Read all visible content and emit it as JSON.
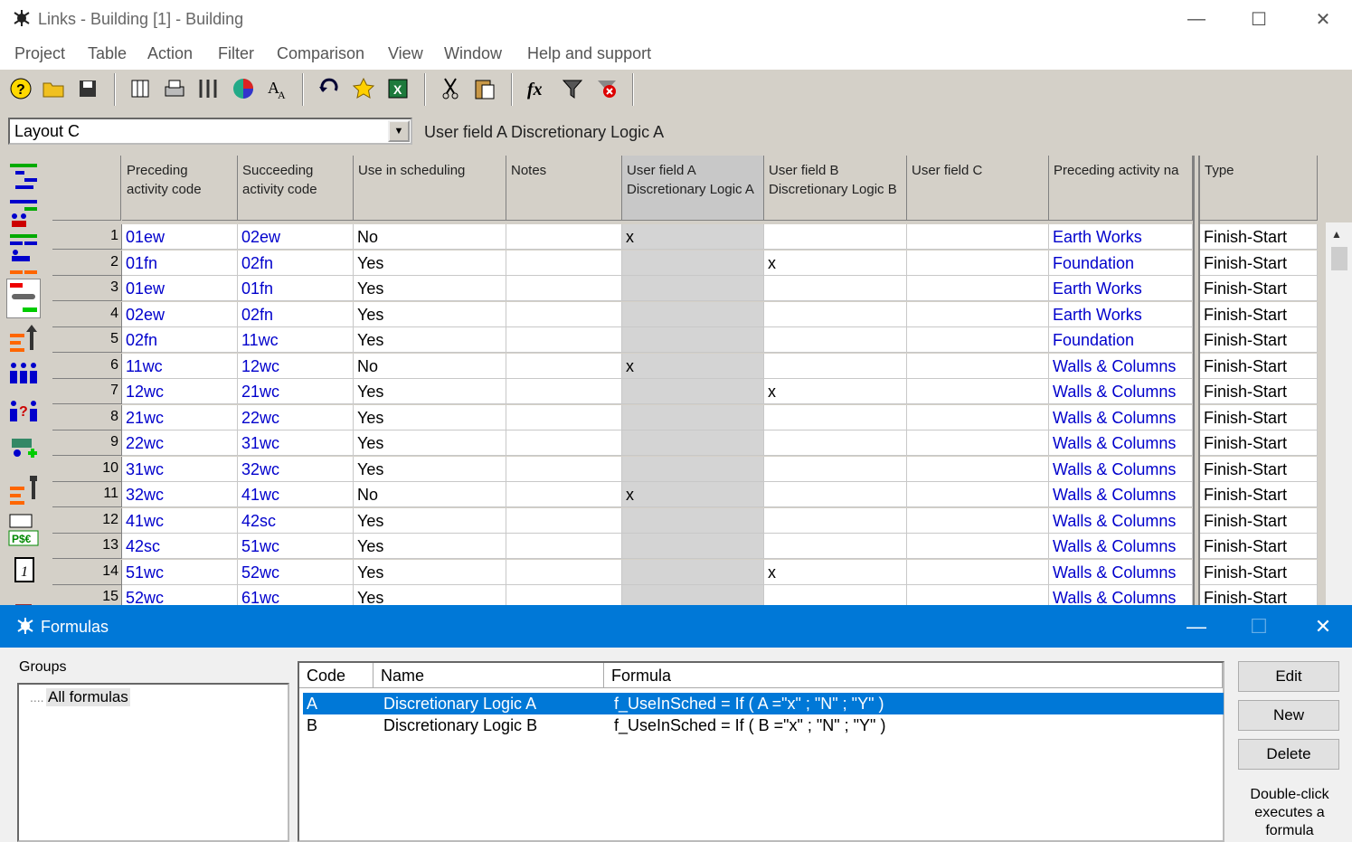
{
  "window": {
    "title": "Links - Building [1] - Building",
    "minimize": "—",
    "maximize": "☐",
    "close": "✕"
  },
  "menu": [
    "Project",
    "Table",
    "Action",
    "Filter",
    "Comparison",
    "View",
    "Window",
    "Help and support"
  ],
  "toolbar_icons": [
    "help-icon",
    "open-folder-icon",
    "save-icon",
    "columns-icon",
    "print-icon",
    "tools-icon",
    "pie-chart-icon",
    "font-icon",
    "undo-icon",
    "star-icon",
    "excel-icon",
    "cut-icon",
    "paste-icon",
    "formula-icon",
    "filter-icon",
    "clear-filter-icon"
  ],
  "layout": {
    "selected": "Layout C",
    "field_caption": "User field A Discretionary Logic A"
  },
  "grid": {
    "columns": [
      {
        "label": "Preceding activity code"
      },
      {
        "label": "Succeeding activity code"
      },
      {
        "label": "Use in scheduling"
      },
      {
        "label": "Notes"
      },
      {
        "label": "User field A Discretionary Logic A"
      },
      {
        "label": "User field B Discretionary Logic B"
      },
      {
        "label": "User field C"
      },
      {
        "label": "Preceding activity na"
      },
      {
        "label": "Type"
      }
    ],
    "rows": [
      {
        "n": "1",
        "pre": "01ew",
        "suc": "02ew",
        "use": "No",
        "notes": "",
        "ufa": "x",
        "ufb": "",
        "ufc": "",
        "name": "Earth Works",
        "type": "Finish-Start"
      },
      {
        "n": "2",
        "pre": "01fn",
        "suc": "02fn",
        "use": "Yes",
        "notes": "",
        "ufa": "",
        "ufb": "x",
        "ufc": "",
        "name": "Foundation",
        "type": "Finish-Start"
      },
      {
        "n": "3",
        "pre": "01ew",
        "suc": "01fn",
        "use": "Yes",
        "notes": "",
        "ufa": "",
        "ufb": "",
        "ufc": "",
        "name": "Earth Works",
        "type": "Finish-Start"
      },
      {
        "n": "4",
        "pre": "02ew",
        "suc": "02fn",
        "use": "Yes",
        "notes": "",
        "ufa": "",
        "ufb": "",
        "ufc": "",
        "name": "Earth Works",
        "type": "Finish-Start"
      },
      {
        "n": "5",
        "pre": "02fn",
        "suc": "11wc",
        "use": "Yes",
        "notes": "",
        "ufa": "",
        "ufb": "",
        "ufc": "",
        "name": "Foundation",
        "type": "Finish-Start"
      },
      {
        "n": "6",
        "pre": "11wc",
        "suc": "12wc",
        "use": "No",
        "notes": "",
        "ufa": "x",
        "ufb": "",
        "ufc": "",
        "name": "Walls & Columns",
        "type": "Finish-Start"
      },
      {
        "n": "7",
        "pre": "12wc",
        "suc": "21wc",
        "use": "Yes",
        "notes": "",
        "ufa": "",
        "ufb": "x",
        "ufc": "",
        "name": "Walls & Columns",
        "type": "Finish-Start"
      },
      {
        "n": "8",
        "pre": "21wc",
        "suc": "22wc",
        "use": "Yes",
        "notes": "",
        "ufa": "",
        "ufb": "",
        "ufc": "",
        "name": "Walls & Columns",
        "type": "Finish-Start"
      },
      {
        "n": "9",
        "pre": "22wc",
        "suc": "31wc",
        "use": "Yes",
        "notes": "",
        "ufa": "",
        "ufb": "",
        "ufc": "",
        "name": "Walls & Columns",
        "type": "Finish-Start"
      },
      {
        "n": "10",
        "pre": "31wc",
        "suc": "32wc",
        "use": "Yes",
        "notes": "",
        "ufa": "",
        "ufb": "",
        "ufc": "",
        "name": "Walls & Columns",
        "type": "Finish-Start"
      },
      {
        "n": "11",
        "pre": "32wc",
        "suc": "41wc",
        "use": "No",
        "notes": "",
        "ufa": "x",
        "ufb": "",
        "ufc": "",
        "name": "Walls & Columns",
        "type": "Finish-Start"
      },
      {
        "n": "12",
        "pre": "41wc",
        "suc": "42sc",
        "use": "Yes",
        "notes": "",
        "ufa": "",
        "ufb": "",
        "ufc": "",
        "name": "Walls & Columns",
        "type": "Finish-Start"
      },
      {
        "n": "13",
        "pre": "42sc",
        "suc": "51wc",
        "use": "Yes",
        "notes": "",
        "ufa": "",
        "ufb": "",
        "ufc": "",
        "name": "Walls & Columns",
        "type": "Finish-Start"
      },
      {
        "n": "14",
        "pre": "51wc",
        "suc": "52wc",
        "use": "Yes",
        "notes": "",
        "ufa": "",
        "ufb": "x",
        "ufc": "",
        "name": "Walls & Columns",
        "type": "Finish-Start"
      },
      {
        "n": "15",
        "pre": "52wc",
        "suc": "61wc",
        "use": "Yes",
        "notes": "",
        "ufa": "",
        "ufb": "",
        "ufc": "",
        "name": "Walls & Columns",
        "type": "Finish-Start"
      }
    ]
  },
  "formulas": {
    "title": "Formulas",
    "groups_label": "Groups",
    "groups": [
      "All formulas"
    ],
    "headers": {
      "code": "Code",
      "name": "Name",
      "formula": "Formula"
    },
    "rows": [
      {
        "code": "A",
        "name": "Discretionary Logic A",
        "formula": "f_UseInSched =  If (  A =\"x\" ; \"N\" ; \"Y\" )"
      },
      {
        "code": "B",
        "name": "Discretionary Logic B",
        "formula": "f_UseInSched =  If (  B =\"x\" ; \"N\" ; \"Y\" )"
      }
    ],
    "buttons": {
      "edit": "Edit",
      "new": "New",
      "delete": "Delete"
    },
    "hint": "Double-click executes a formula"
  }
}
